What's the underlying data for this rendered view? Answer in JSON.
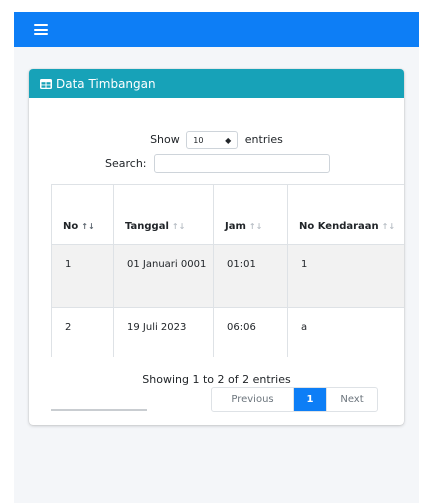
{
  "header": {
    "menu_icon": "hamburger-icon",
    "accent": "#0d7ef6"
  },
  "card": {
    "title": "Data Timbangan",
    "title_icon": "table-icon",
    "header_color": "#17a2b8"
  },
  "controls": {
    "show_label": "Show",
    "page_length": "10",
    "entries_label": "entries",
    "search_label": "Search:",
    "search_value": ""
  },
  "table": {
    "columns": [
      "No",
      "Tanggal",
      "Jam",
      "No Kendaraan"
    ],
    "sort_icons": {
      "active": "↑↓",
      "inactive": "↑↓"
    },
    "rows": [
      {
        "no": "1",
        "tanggal": "01 Januari 0001",
        "jam": "01:01",
        "no_kendaraan": "1"
      },
      {
        "no": "2",
        "tanggal": "19 Juli 2023",
        "jam": "06:06",
        "no_kendaraan": "a"
      }
    ]
  },
  "footer": {
    "info": "Showing 1 to 2 of 2 entries",
    "prev_label": "Previous",
    "current_page": "1",
    "next_label": "Next"
  }
}
